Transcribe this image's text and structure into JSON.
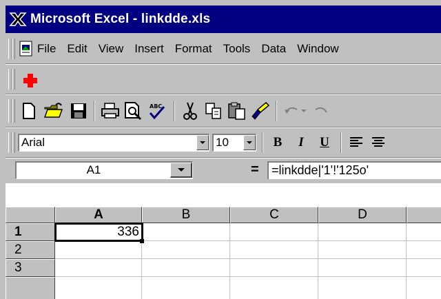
{
  "window": {
    "title": "Microsoft Excel - linkdde.xls",
    "app_icon": "excel-x-icon"
  },
  "menu": {
    "items": [
      {
        "label": "File"
      },
      {
        "label": "Edit"
      },
      {
        "label": "View"
      },
      {
        "label": "Insert"
      },
      {
        "label": "Format"
      },
      {
        "label": "Tools"
      },
      {
        "label": "Data"
      },
      {
        "label": "Window"
      }
    ]
  },
  "format": {
    "font": "Arial",
    "size": "10"
  },
  "formula_bar": {
    "name_box": "A1",
    "equals": "=",
    "formula": "=linkdde|'1'!'125o'"
  },
  "sheet": {
    "columns": [
      "A",
      "B",
      "C",
      "D"
    ],
    "rows": [
      "1",
      "2",
      "3"
    ],
    "cells": {
      "A1": "336"
    },
    "active_cell": "A1"
  },
  "colors": {
    "title_bg": "#000080",
    "chrome": "#c0c0c0",
    "red_cross": "#ff0000"
  }
}
